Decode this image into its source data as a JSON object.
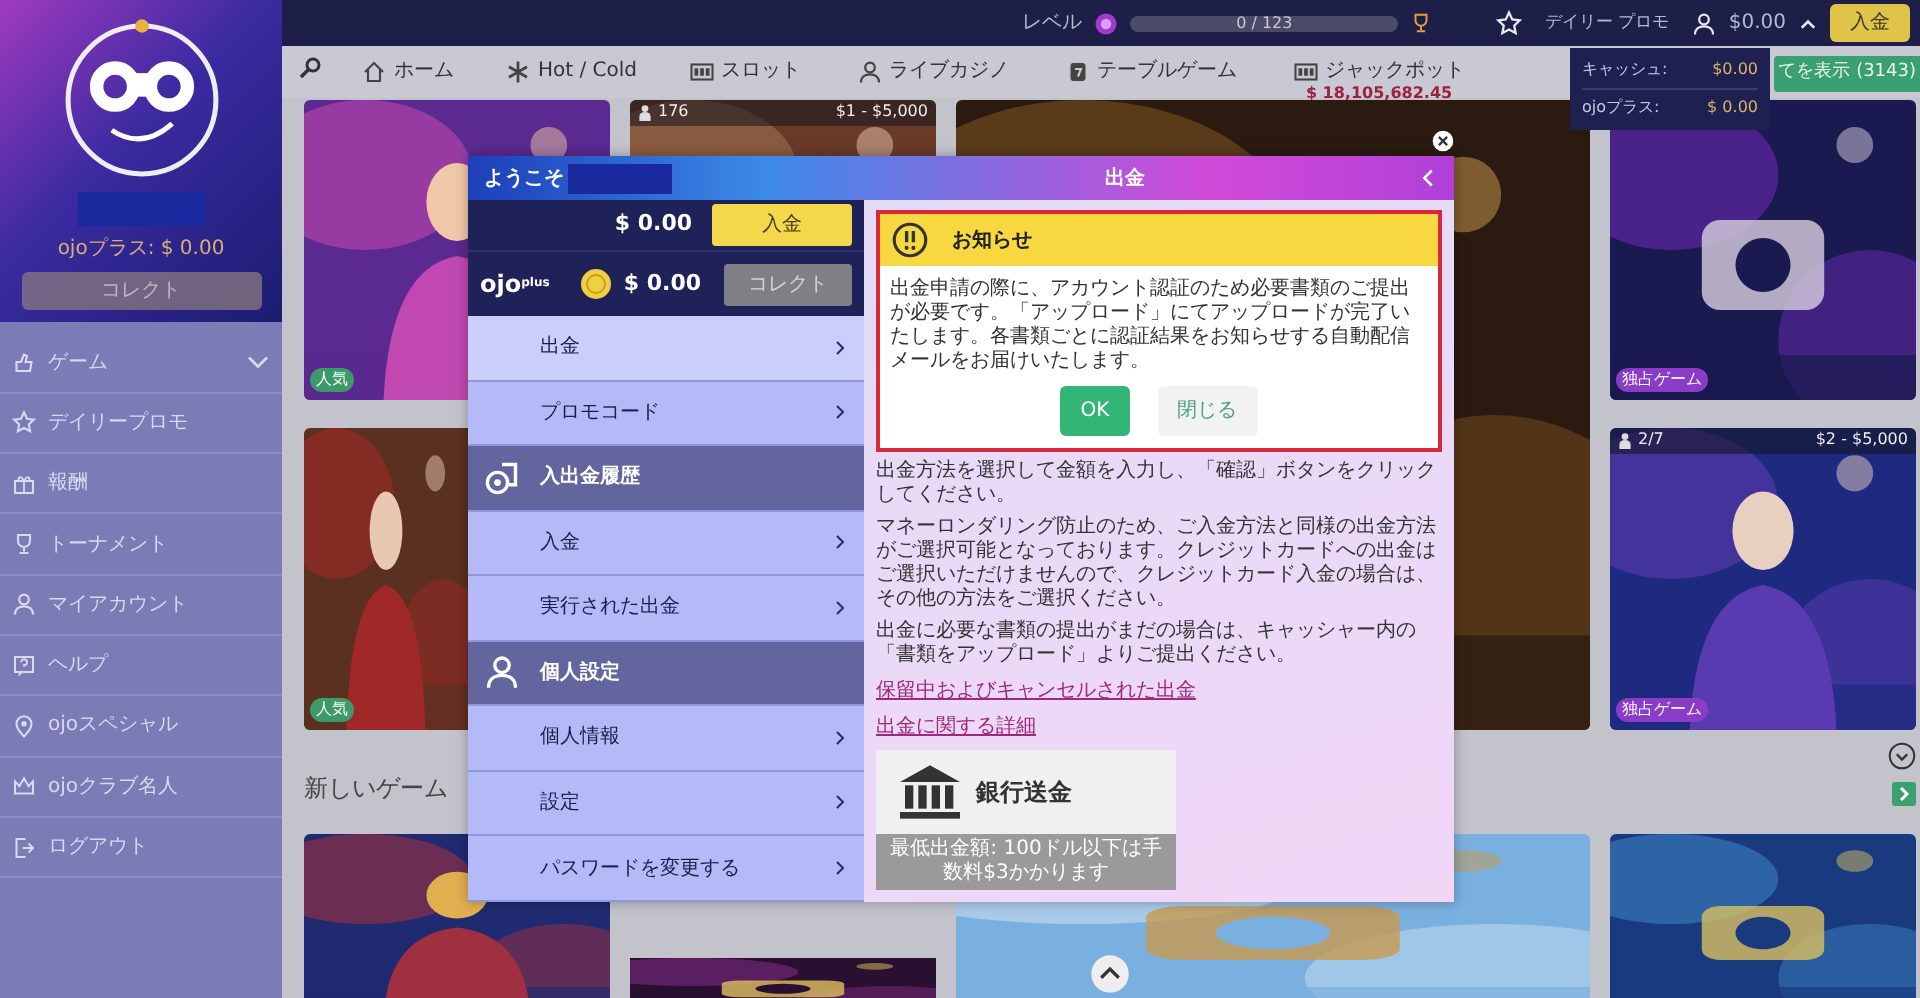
{
  "sidebar": {
    "plus_balance": "ojoプラス: $ 0.00",
    "collect_button": {
      "label": "コレクト",
      "disabled": true
    },
    "items": [
      {
        "label": "ゲーム",
        "kind": "group"
      },
      {
        "label": "デイリープロモ",
        "kind": "link"
      },
      {
        "label": "報酬",
        "kind": "link"
      },
      {
        "label": "トーナメント",
        "kind": "link"
      },
      {
        "label": "マイアカウント",
        "kind": "link"
      },
      {
        "label": "ヘルプ",
        "kind": "link"
      },
      {
        "label": "ojoスペシャル",
        "kind": "link"
      },
      {
        "label": "ojoクラブ名人",
        "kind": "link"
      },
      {
        "label": "ログアウト",
        "kind": "link"
      }
    ]
  },
  "topbar": {
    "level_label": "レベル",
    "level_progress": {
      "level": 0,
      "reading": "0 / 123"
    },
    "daily_promo": "デイリー プロモ",
    "balance": "$0.00",
    "deposit_button": "入金"
  },
  "nav": {
    "items": [
      {
        "label": "ホーム"
      },
      {
        "label": "Hot / Cold"
      },
      {
        "label": "スロット"
      },
      {
        "label": "ライブカジノ"
      },
      {
        "label": "テーブルゲーム"
      },
      {
        "label": "ジャックポット",
        "amount": "$ 18,105,682.45"
      }
    ],
    "show_all_button": "てを表示 (3143)"
  },
  "cashier_dropdown": {
    "rows": [
      {
        "label": "キャッシュ:",
        "value": "$0.00"
      },
      {
        "label": "ojoプラス:",
        "value": "$ 0.00"
      }
    ]
  },
  "games": {
    "heading": "新しいゲーム",
    "tiles": [
      {
        "kind": "picture",
        "badges": [
          {
            "kind": "tag",
            "text": "人気",
            "color": "#3c9a6a"
          }
        ]
      },
      {
        "kind": "picture",
        "badges": [
          {
            "kind": "players",
            "text": "176"
          },
          {
            "kind": "limits",
            "text": "$1 - $5,000"
          }
        ]
      },
      {
        "kind": "picture"
      },
      {
        "kind": "picture",
        "badges": [
          {
            "kind": "tag",
            "text": "独占ゲーム",
            "color": "#8a3cc8"
          }
        ]
      },
      {
        "kind": "picture",
        "badges": [
          {
            "kind": "tag",
            "text": "人気",
            "color": "#3c9a6a"
          }
        ]
      },
      {
        "kind": "picture",
        "badges": [
          {
            "kind": "players",
            "text": "2/7"
          },
          {
            "kind": "limits",
            "text": "$2 - $5,000"
          },
          {
            "kind": "tag",
            "text": "独占ゲーム",
            "color": "#8a3cc8"
          }
        ]
      },
      {
        "kind": "picture"
      },
      {
        "kind": "picture"
      },
      {
        "kind": "picture"
      },
      {
        "kind": "picture"
      }
    ]
  },
  "modal": {
    "welcome": "ようこそ",
    "title": "出金",
    "balance": "$ 0.00",
    "deposit_button": "入金",
    "plus_logo": "ojo$^{plus}$",
    "plus_balance": "$ 0.00",
    "collect_button": {
      "label": "コレクト",
      "disabled": true
    },
    "menu": [
      {
        "label": "出金",
        "kind": "link",
        "selected": true
      },
      {
        "label": "プロモコード",
        "kind": "link",
        "selected": false
      },
      {
        "label": "入出金履歴",
        "kind": "section",
        "selected": false
      },
      {
        "label": "入金",
        "kind": "link",
        "selected": false
      },
      {
        "label": "実行された出金",
        "kind": "link",
        "selected": false
      },
      {
        "label": "個人設定",
        "kind": "section",
        "selected": false
      },
      {
        "label": "個人情報",
        "kind": "link",
        "selected": false
      },
      {
        "label": "設定",
        "kind": "link",
        "selected": false
      },
      {
        "label": "パスワードを変更する",
        "kind": "link",
        "selected": false
      }
    ],
    "notice": {
      "title": "お知らせ",
      "body": "出金申請の際に、アカウント認証のため必要書類のご提出が必要です。「アップロード」にてアップロードが完了いたします。各書類ごとに認証結果をお知らせする自動配信メールをお届けいたします。",
      "buttons": [
        {
          "label": "OK",
          "kind": "primary"
        },
        {
          "label": "閉じる",
          "kind": "secondary"
        }
      ]
    },
    "paragraphs": [
      "出金方法を選択して金額を入力し、「確認」ボタンをクリックしてください。",
      "マネーロンダリング防止のため、ご入金方法と同様の出金方法がご選択可能となっております。クレジットカードへの出金はご選択いただけませんので、クレジットカード入金の場合は、その他の方法をご選択ください。",
      "出金に必要な書類の提出がまだの場合は、キャッシャー内の「書類をアップロード」よりご提出ください。"
    ],
    "links": [
      "保留中およびキャンセルされた出金",
      "出金に関する詳細"
    ],
    "methods": [
      {
        "label": "銀行送金",
        "caption": "最低出金額: 100ドル以下は手数料$3かかります"
      }
    ]
  }
}
